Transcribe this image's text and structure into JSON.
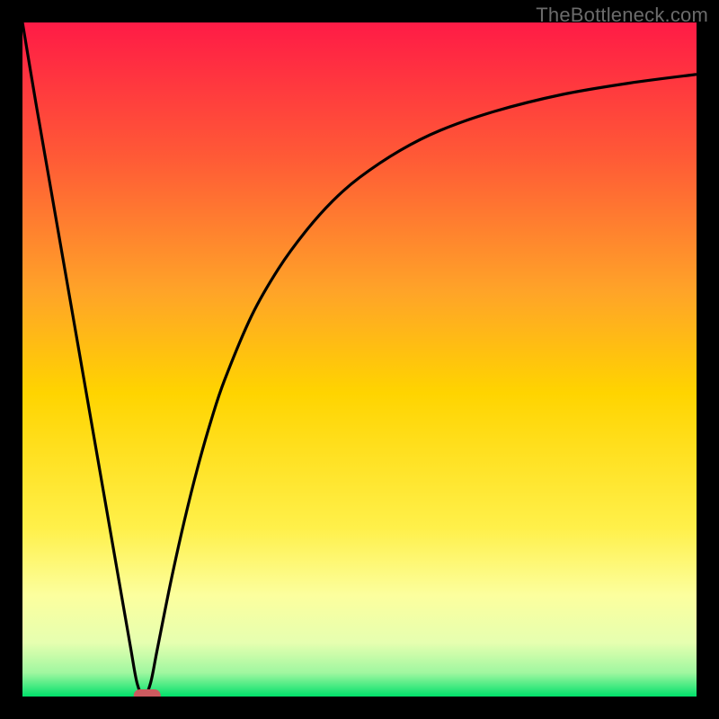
{
  "watermark": "TheBottleneck.com",
  "colors": {
    "gradient_top": "#ff1b46",
    "gradient_upper_mid": "#ff7a2a",
    "gradient_mid": "#ffd400",
    "gradient_lower_mid": "#fffb8a",
    "gradient_low": "#f3ffb8",
    "gradient_bottom": "#00e06a",
    "curve": "#000000",
    "marker": "#cc5a5f",
    "frame": "#000000"
  },
  "chart_data": {
    "type": "line",
    "title": "",
    "xlabel": "",
    "ylabel": "",
    "xlim": [
      0,
      100
    ],
    "ylim": [
      0,
      100
    ],
    "series": [
      {
        "name": "bottleneck-curve",
        "x": [
          0,
          2,
          4,
          6,
          8,
          10,
          12,
          14,
          16,
          17,
          18,
          19,
          20,
          22,
          24,
          26,
          28,
          30,
          34,
          38,
          42,
          46,
          50,
          56,
          62,
          70,
          80,
          90,
          100
        ],
        "y": [
          100,
          88,
          76.5,
          65,
          53.5,
          42,
          30.5,
          19,
          7.5,
          2,
          0,
          2,
          7,
          17,
          26,
          34,
          41,
          47,
          56.5,
          63.5,
          69,
          73.5,
          77,
          81,
          84,
          86.8,
          89.3,
          91,
          92.3
        ]
      }
    ],
    "marker": {
      "name": "optimal-point",
      "x_range": [
        16.5,
        20.5
      ],
      "y": 0
    },
    "gradient_stops": [
      {
        "offset": 0.0,
        "color": "#ff1b46"
      },
      {
        "offset": 0.2,
        "color": "#ff5a36"
      },
      {
        "offset": 0.4,
        "color": "#ffa428"
      },
      {
        "offset": 0.55,
        "color": "#ffd400"
      },
      {
        "offset": 0.75,
        "color": "#fff04a"
      },
      {
        "offset": 0.85,
        "color": "#fcff9e"
      },
      {
        "offset": 0.92,
        "color": "#e6ffb0"
      },
      {
        "offset": 0.965,
        "color": "#9ff7a0"
      },
      {
        "offset": 1.0,
        "color": "#00e06a"
      }
    ]
  }
}
